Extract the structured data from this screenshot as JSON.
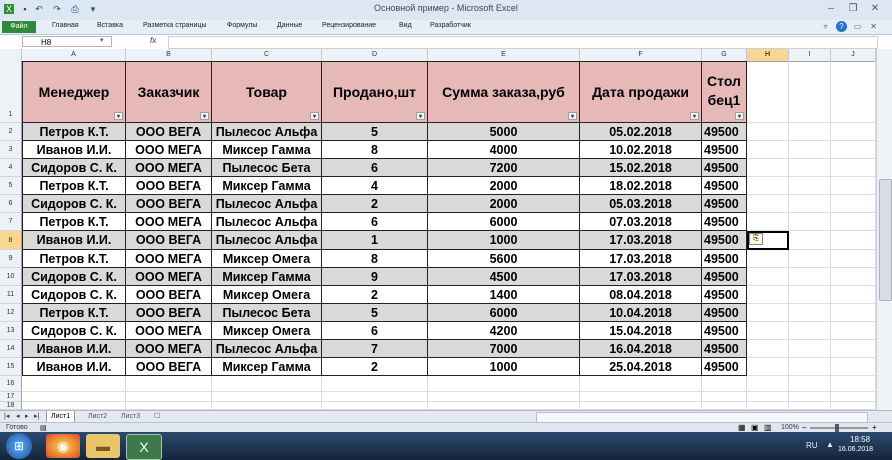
{
  "window": {
    "title": "Основной пример - Microsoft Excel",
    "file_tab": "Файл",
    "ribbon_tabs": [
      "Главная",
      "Вставка",
      "Разметка страницы",
      "Формулы",
      "Данные",
      "Рецензирование",
      "Вид",
      "Разработчик"
    ]
  },
  "formula_bar": {
    "name_box": "H8",
    "fx": "fx",
    "value": ""
  },
  "columns": [
    "A",
    "B",
    "C",
    "D",
    "E",
    "F",
    "G",
    "H",
    "I",
    "J"
  ],
  "rows": [
    "1",
    "2",
    "3",
    "4",
    "5",
    "6",
    "7",
    "8",
    "9",
    "10",
    "11",
    "12",
    "13",
    "14",
    "15",
    "16",
    "17",
    "18"
  ],
  "selected_cell": "H8",
  "headers": [
    "Менеджер",
    "Заказчик",
    "Товар",
    "Продано,шт",
    "Сумма заказа,руб",
    "Дата продажи",
    "Стол бец1"
  ],
  "table": [
    [
      "Петров К.Т.",
      "ООО ВЕГА",
      "Пылесос Альфа",
      "5",
      "5000",
      "05.02.2018",
      "49500"
    ],
    [
      "Иванов И.И.",
      "ООО МЕГА",
      "Миксер Гамма",
      "8",
      "4000",
      "10.02.2018",
      "49500"
    ],
    [
      "Сидоров С. К.",
      "ООО МЕГА",
      "Пылесос Бета",
      "6",
      "7200",
      "15.02.2018",
      "49500"
    ],
    [
      "Петров К.Т.",
      "ООО ВЕГА",
      "Миксер Гамма",
      "4",
      "2000",
      "18.02.2018",
      "49500"
    ],
    [
      "Сидоров С. К.",
      "ООО ВЕГА",
      "Пылесос Альфа",
      "2",
      "2000",
      "05.03.2018",
      "49500"
    ],
    [
      "Петров К.Т.",
      "ООО МЕГА",
      "Пылесос Альфа",
      "6",
      "6000",
      "07.03.2018",
      "49500"
    ],
    [
      "Иванов И.И.",
      "ООО ВЕГА",
      "Пылесос Альфа",
      "1",
      "1000",
      "17.03.2018",
      "49500"
    ],
    [
      "Петров К.Т.",
      "ООО МЕГА",
      "Миксер Омега",
      "8",
      "5600",
      "17.03.2018",
      "49500"
    ],
    [
      "Сидоров С. К.",
      "ООО МЕГА",
      "Миксер Гамма",
      "9",
      "4500",
      "17.03.2018",
      "49500"
    ],
    [
      "Сидоров С. К.",
      "ООО ВЕГА",
      "Миксер Омега",
      "2",
      "1400",
      "08.04.2018",
      "49500"
    ],
    [
      "Петров К.Т.",
      "ООО ВЕГА",
      "Пылесос Бета",
      "5",
      "6000",
      "10.04.2018",
      "49500"
    ],
    [
      "Сидоров С. К.",
      "ООО МЕГА",
      "Миксер Омега",
      "6",
      "4200",
      "15.04.2018",
      "49500"
    ],
    [
      "Иванов И.И.",
      "ООО МЕГА",
      "Пылесос Альфа",
      "7",
      "7000",
      "16.04.2018",
      "49500"
    ],
    [
      "Иванов И.И.",
      "ООО ВЕГА",
      "Миксер Гамма",
      "2",
      "1000",
      "25.04.2018",
      "49500"
    ]
  ],
  "sheets": [
    "Лист1",
    "Лист2",
    "Лист3"
  ],
  "active_sheet": "Лист1",
  "status": {
    "ready": "Готово",
    "zoom": "100%"
  },
  "taskbar": {
    "lang": "RU",
    "time": "18:58",
    "date": "16.06.2018"
  },
  "colors": {
    "header_fill": "#e6b9b8",
    "band_fill": "#d9d9d9",
    "selection": "#f8d890",
    "file_tab": "#2e8b3a"
  }
}
